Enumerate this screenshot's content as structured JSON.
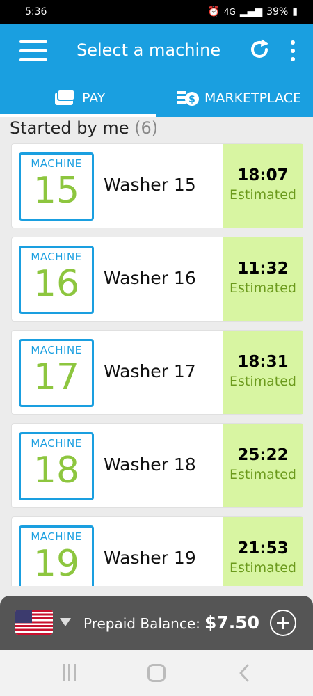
{
  "status_bar": {
    "time": "5:36",
    "network": "4G",
    "battery": "39%"
  },
  "app_bar": {
    "title": "Select a machine"
  },
  "tabs": [
    {
      "label": "PAY",
      "icon": "card-wallet-icon"
    },
    {
      "label": "MARKETPLACE",
      "icon": "coins-dollar-icon"
    }
  ],
  "section": {
    "title": "Started by me",
    "count": "(6)"
  },
  "machines": [
    {
      "machine_label": "MACHINE",
      "number": "15",
      "name": "Washer 15",
      "time": "18:07",
      "status": "Estimated"
    },
    {
      "machine_label": "MACHINE",
      "number": "16",
      "name": "Washer 16",
      "time": "11:32",
      "status": "Estimated"
    },
    {
      "machine_label": "MACHINE",
      "number": "17",
      "name": "Washer 17",
      "time": "18:31",
      "status": "Estimated"
    },
    {
      "machine_label": "MACHINE",
      "number": "18",
      "name": "Washer 18",
      "time": "25:22",
      "status": "Estimated"
    },
    {
      "machine_label": "MACHINE",
      "number": "19",
      "name": "Washer 19",
      "time": "21:53",
      "status": "Estimated"
    }
  ],
  "bottom_bar": {
    "prepaid_label": "Prepaid Balance:",
    "balance": "$7.50",
    "flag_icon": "us-flag-icon"
  },
  "colors": {
    "primary": "#1a9fe0",
    "accent_green": "#8dc63f",
    "estimate_bg": "#d8f5a2"
  }
}
